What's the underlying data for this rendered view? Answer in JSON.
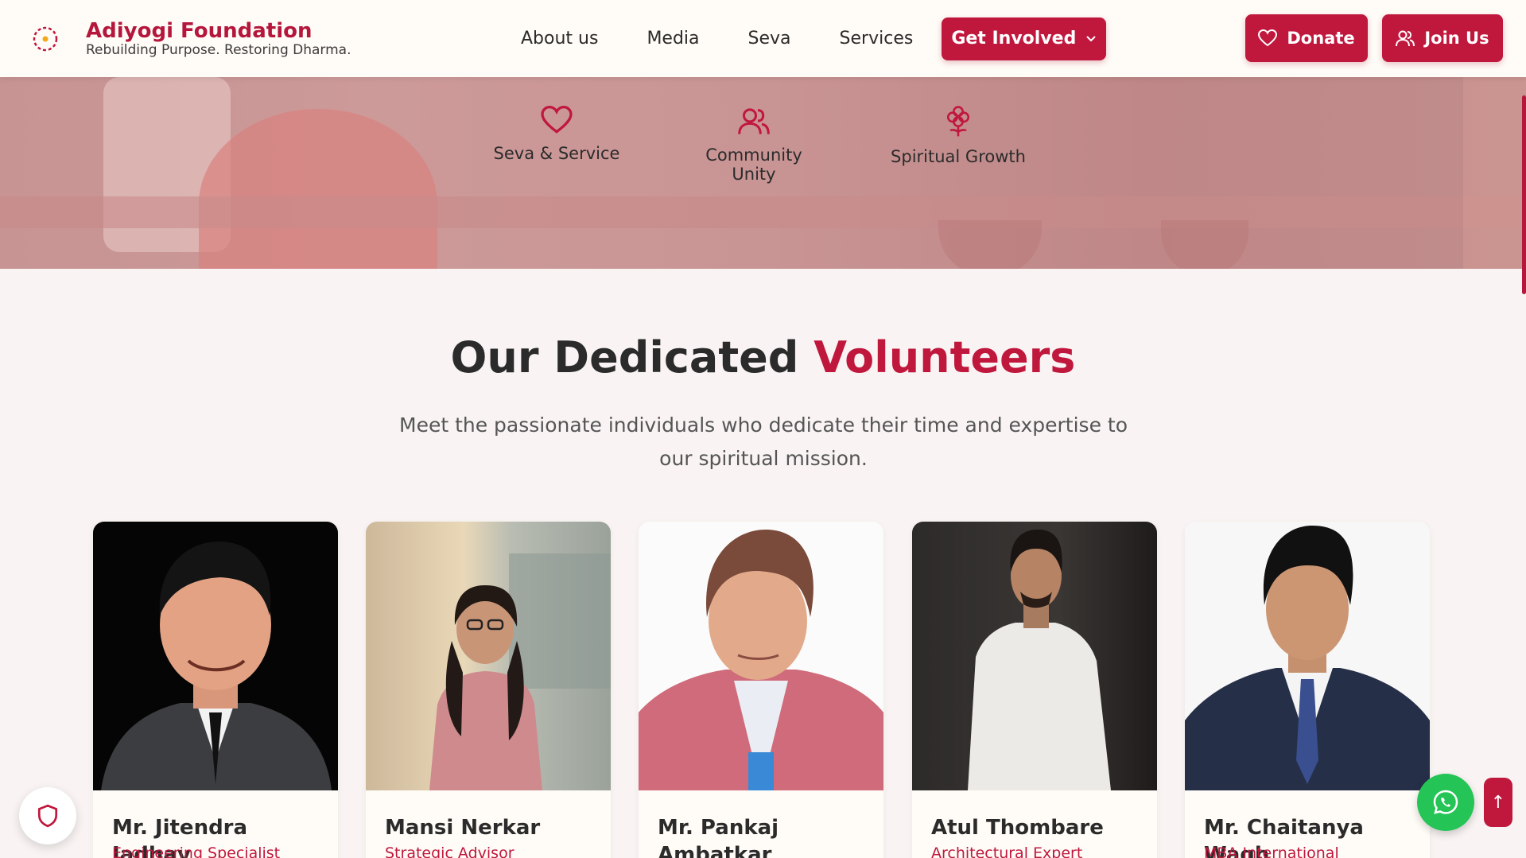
{
  "header": {
    "brand_title": "Adiyogi Foundation",
    "brand_tagline": "Rebuilding Purpose. Restoring Dharma.",
    "nav": [
      "About us",
      "Media",
      "Seva",
      "Services"
    ],
    "get_involved_label": "Get Involved",
    "donate_label": "Donate",
    "join_label": "Join Us"
  },
  "hero": {
    "features": [
      {
        "label": "Seva & Service",
        "icon": "heart-icon"
      },
      {
        "label": "Community Unity",
        "icon": "users-icon"
      },
      {
        "label": "Spiritual Growth",
        "icon": "flower-icon"
      }
    ]
  },
  "volunteers": {
    "title_plain": "Our Dedicated",
    "title_accent": "Volunteers",
    "subtitle": "Meet the passionate individuals who dedicate their time and expertise to our spiritual mission.",
    "members": [
      {
        "name": "Mr. Jitendra Jadhav",
        "role": "Engineering Specialist"
      },
      {
        "name": "Mansi Nerkar",
        "role": "Strategic Advisor"
      },
      {
        "name": "Mr. Pankaj Ambatkar",
        "role": ""
      },
      {
        "name": "Atul Thombare",
        "role": "Architectural Expert"
      },
      {
        "name": "Mr. Chaitanya Wagh",
        "role": "MBA International"
      }
    ]
  },
  "colors": {
    "brand": "#c0173d",
    "whatsapp": "#25c456",
    "background": "#f9f4f3"
  }
}
